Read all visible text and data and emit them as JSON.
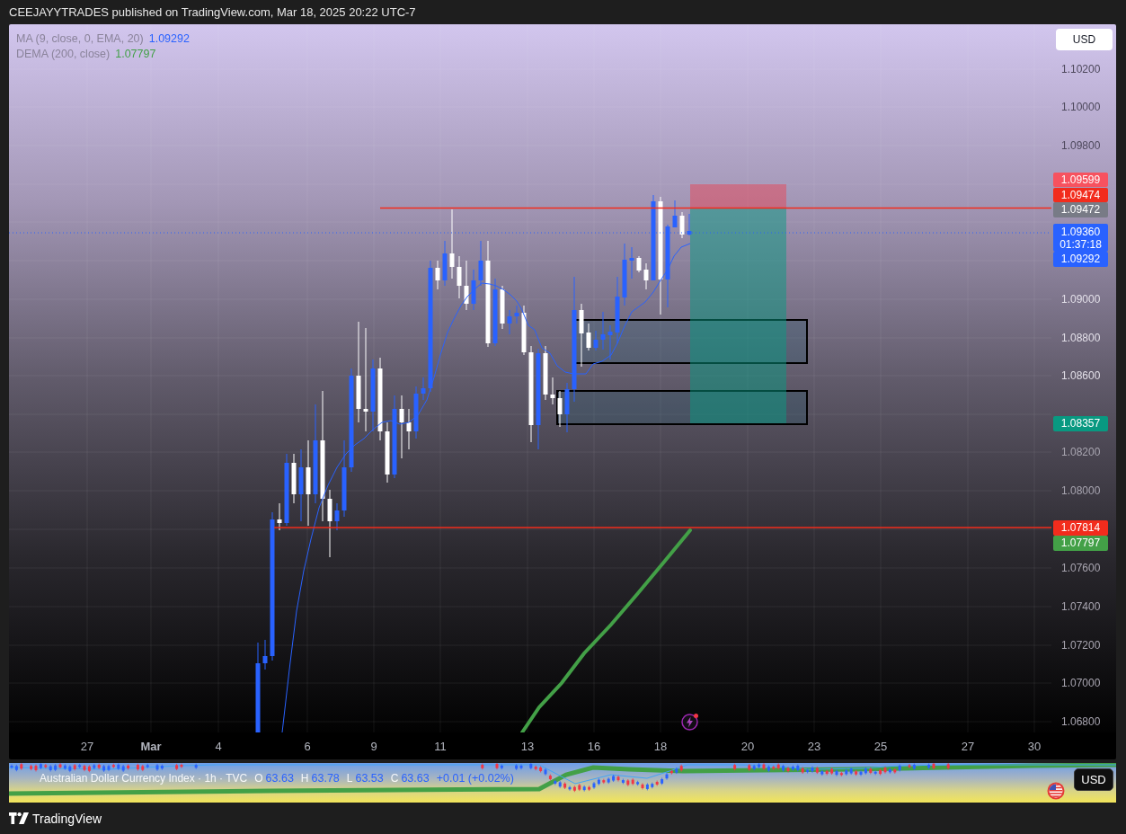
{
  "header": {
    "text": "CEEJAYYTRADES published on TradingView.com, Mar 18, 2025 20:22 UTC-7"
  },
  "chart": {
    "legend": [
      {
        "name": "MA (9, close, 0, EMA, 20)",
        "value": "1.09292",
        "color": "#2962ff"
      },
      {
        "name": "DEMA (200, close)",
        "value": "1.07797",
        "color": "#43a047"
      }
    ]
  },
  "price_axis": {
    "currency_button": "USD",
    "ticks": [
      "1.10200",
      "1.10000",
      "1.09800",
      "1.09000",
      "1.08800",
      "1.08600",
      "1.08200",
      "1.08000",
      "1.07600",
      "1.07400",
      "1.07200",
      "1.07000",
      "1.06800"
    ],
    "labels": [
      {
        "value": "1.09599",
        "color": "#f7525f"
      },
      {
        "value": "1.09474",
        "color": "#f22c1d"
      },
      {
        "value": "1.09472",
        "color": "#787b86"
      },
      {
        "value": "1.09360",
        "countdown": "01:37:18",
        "color": "#2962ff"
      },
      {
        "value": "1.09292",
        "color": "#2962ff"
      },
      {
        "value": "1.08357",
        "color": "#089981"
      },
      {
        "value": "1.07814",
        "color": "#f22c1d"
      },
      {
        "value": "1.07797",
        "color": "#43a047"
      }
    ]
  },
  "time_axis": {
    "ticks": [
      {
        "label": "27",
        "kind": "day"
      },
      {
        "label": "Mar",
        "kind": "month"
      },
      {
        "label": "4",
        "kind": "day"
      },
      {
        "label": "6",
        "kind": "day"
      },
      {
        "label": "9",
        "kind": "day"
      },
      {
        "label": "11",
        "kind": "day"
      },
      {
        "label": "13",
        "kind": "day"
      },
      {
        "label": "16",
        "kind": "day"
      },
      {
        "label": "18",
        "kind": "day"
      },
      {
        "label": "20",
        "kind": "day"
      },
      {
        "label": "23",
        "kind": "day"
      },
      {
        "label": "25",
        "kind": "day"
      },
      {
        "label": "27",
        "kind": "day"
      },
      {
        "label": "30",
        "kind": "day"
      }
    ]
  },
  "index_pane": {
    "title": "Australian Dollar Currency Index · 1h · TVC",
    "ohlc": [
      {
        "label": "O",
        "value": "63.63"
      },
      {
        "label": "H",
        "value": "63.78"
      },
      {
        "label": "L",
        "value": "63.53"
      },
      {
        "label": "C",
        "value": "63.63"
      }
    ],
    "change": "+0.01 (+0.02%)",
    "currency_button": "USD"
  },
  "footer": {
    "brand": "TradingView"
  }
}
